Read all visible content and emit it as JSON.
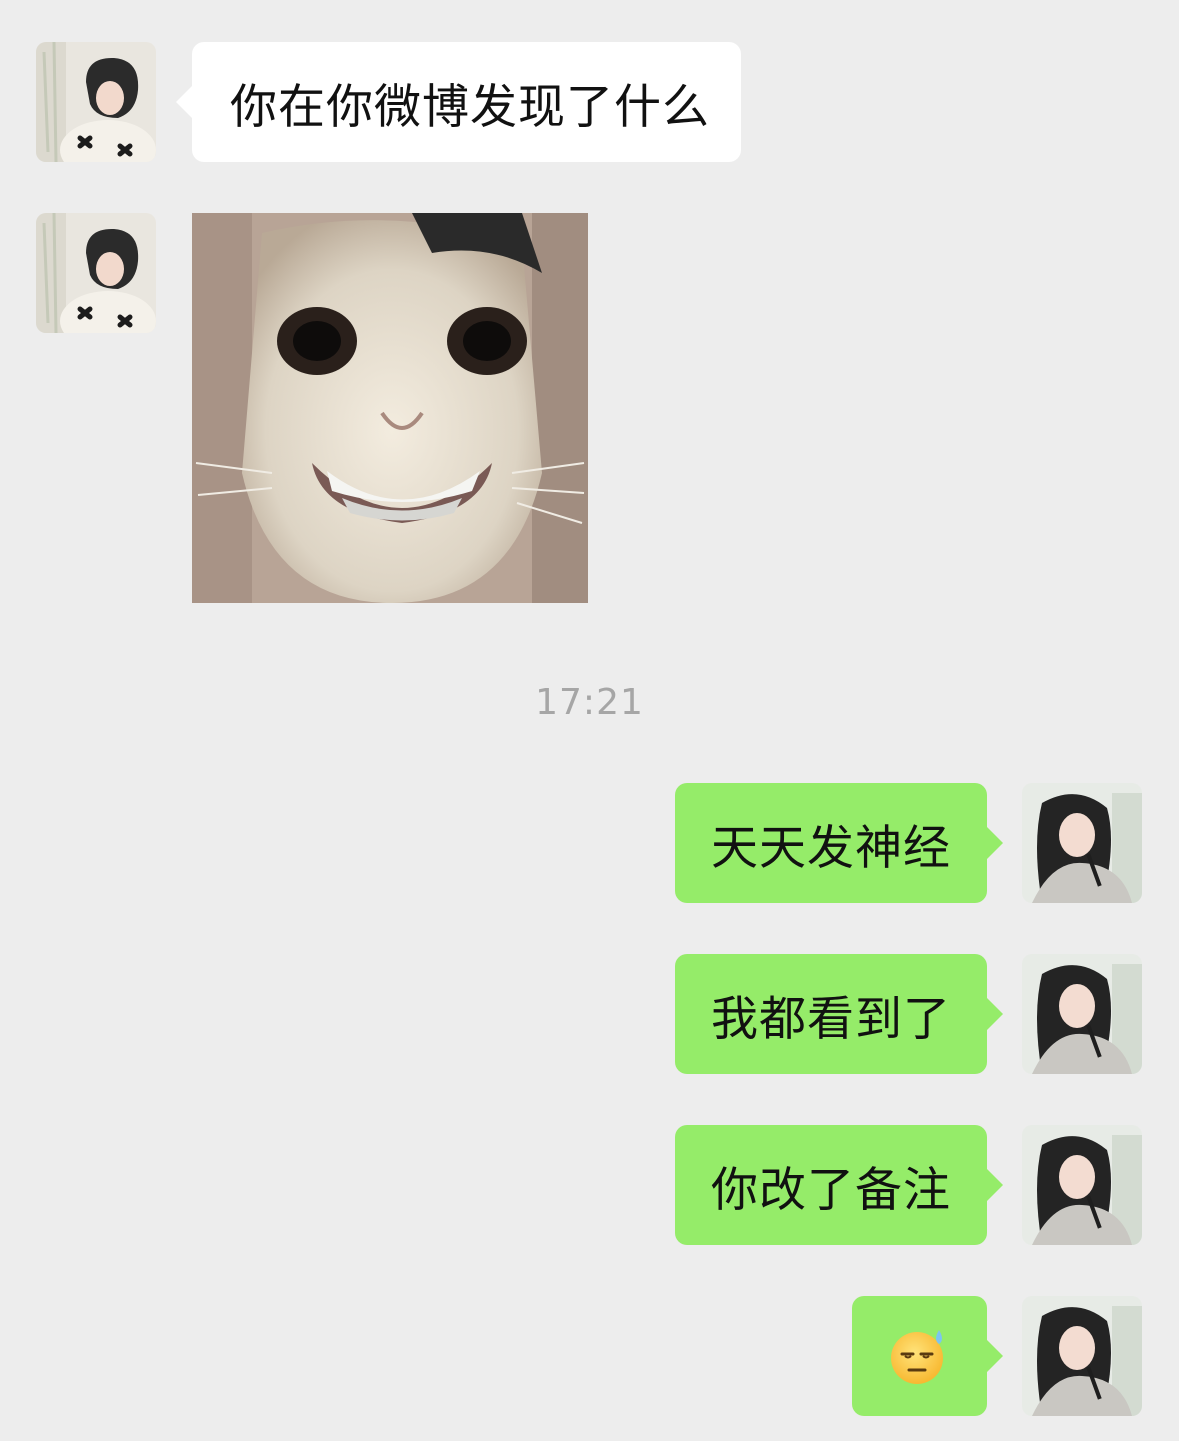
{
  "chat": {
    "timestamp": "17:21",
    "incoming": [
      {
        "type": "text",
        "text": "你在你微博发现了什么"
      },
      {
        "type": "sticker",
        "icon": "grinning-cat-face-sticker"
      }
    ],
    "outgoing": [
      {
        "type": "text",
        "text": "天天发神经"
      },
      {
        "type": "text",
        "text": "我都看到了"
      },
      {
        "type": "text",
        "text": "你改了备注"
      },
      {
        "type": "emoji",
        "icon": "unamused-face-with-sweat-emoji"
      }
    ]
  },
  "colors": {
    "background": "#ededed",
    "incoming_bubble": "#ffffff",
    "outgoing_bubble": "#95ec69",
    "timestamp_text": "#a6a6a6"
  }
}
